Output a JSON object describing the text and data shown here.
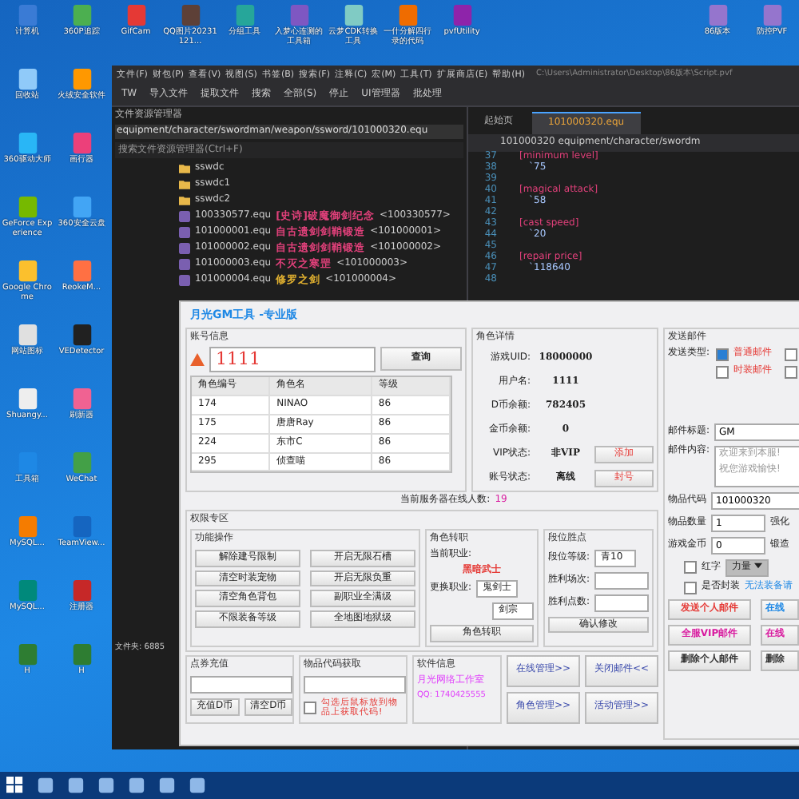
{
  "desktop": {
    "top_icons": [
      {
        "label": "计算机",
        "color": "#3a7bd5"
      },
      {
        "label": "360P追踪",
        "color": "#4caf50"
      },
      {
        "label": "GifCam",
        "color": "#e53935"
      },
      {
        "label": "QQ图片20231121...",
        "color": "#5d4037"
      },
      {
        "label": "分组工具",
        "color": "#26a69a"
      },
      {
        "label": "入梦心连测的工具箱",
        "color": "#7e57c2"
      },
      {
        "label": "云梦CDK转换工具",
        "color": "#80cbc4"
      },
      {
        "label": "一什分解四行录的代码",
        "color": "#ef6c00"
      },
      {
        "label": "pvfUtility",
        "color": "#8e24aa"
      }
    ],
    "right_icons": [
      {
        "label": "86版本",
        "color": "#9575cd"
      },
      {
        "label": "防控PVF",
        "color": "#9575cd"
      }
    ],
    "left_icons": [
      {
        "label": "回收站",
        "color": "#90caf9"
      },
      {
        "label": "火绒安全软件",
        "color": "#ff9800"
      },
      {
        "label": "360驱动大师",
        "color": "#29b6f6"
      },
      {
        "label": "画行器",
        "color": "#ec407a"
      },
      {
        "label": "GeForce Experience",
        "color": "#76b900"
      },
      {
        "label": "360安全云盘",
        "color": "#42a5f5"
      },
      {
        "label": "Google Chrome",
        "color": "#fbc02d"
      },
      {
        "label": "ReokeM...",
        "color": "#ff7043"
      },
      {
        "label": "网站图标",
        "color": "#e0e0e0"
      },
      {
        "label": "VEDetector",
        "color": "#212121"
      },
      {
        "label": "Shuangy...",
        "color": "#eeeeee"
      },
      {
        "label": "刷新器",
        "color": "#f06292"
      },
      {
        "label": "工具箱",
        "color": "#1e88e5"
      },
      {
        "label": "WeChat",
        "color": "#43a047"
      },
      {
        "label": "MySQL...",
        "color": "#f57c00"
      },
      {
        "label": "TeamView...",
        "color": "#1565c0"
      },
      {
        "label": "MySQL...",
        "color": "#00897b"
      },
      {
        "label": "注册器",
        "color": "#c62828"
      },
      {
        "label": "H",
        "color": "#2e7d32"
      },
      {
        "label": "H",
        "color": "#2e7d32"
      }
    ]
  },
  "editor": {
    "menu": [
      "文件(F)",
      "财包(P)",
      "查看(V)",
      "视图(S)",
      "书签(B)",
      "搜索(F)",
      "注释(C)",
      "宏(M)",
      "工具(T)",
      "扩展商店(E)",
      "帮助(H)"
    ],
    "path": "C:\\Users\\Administrator\\Desktop\\86版本\\Script.pvf",
    "toolbar": [
      "TW",
      "导入文件",
      "提取文件",
      "搜索",
      "全部(S)",
      "停止",
      "UI管理器",
      "批处理"
    ],
    "explorer": {
      "title": "文件资源管理器",
      "path": "equipment/character/swordman/weapon/ssword/101000320.equ",
      "search_placeholder": "搜索文件资源管理器(Ctrl+F)",
      "folders": [
        "sswdc",
        "sswdc1",
        "sswdc2"
      ],
      "files": [
        {
          "name": "100330577.equ",
          "desc": "[史诗]破魔御剑纪念",
          "code": "<100330577>",
          "color": "#e0407a"
        },
        {
          "name": "101000001.equ",
          "desc": "自古遗剑剑鞘锻造",
          "code": "<101000001>",
          "color": "#e0407a"
        },
        {
          "name": "101000002.equ",
          "desc": "自古遗剑剑鞘锻造",
          "code": "<101000002>",
          "color": "#e0407a"
        },
        {
          "name": "101000003.equ",
          "desc": "不灭之寒罡",
          "code": "<101000003>",
          "color": "#e0407a"
        },
        {
          "name": "101000004.equ",
          "desc": "修罗之剑",
          "code": "<101000004>",
          "color": "#e0b030"
        }
      ],
      "status": "文件夹: 6885"
    },
    "tabs": [
      {
        "label": "起始页",
        "selected": false
      },
      {
        "label": "101000320.equ",
        "selected": true
      }
    ],
    "code_path": "101000320  equipment/character/swordm",
    "lines": [
      {
        "no": "37",
        "text": "[minimum level]",
        "kind": "tag"
      },
      {
        "no": "38",
        "text": "`75",
        "kind": "value"
      },
      {
        "no": "39",
        "kind": "blank"
      },
      {
        "no": "40",
        "text": "[magical attack]",
        "kind": "tag"
      },
      {
        "no": "41",
        "text": "`58",
        "kind": "value"
      },
      {
        "no": "42",
        "kind": "blank"
      },
      {
        "no": "43",
        "text": "[cast speed]",
        "kind": "tag"
      },
      {
        "no": "44",
        "text": "`20",
        "kind": "value"
      },
      {
        "no": "45",
        "kind": "blank"
      },
      {
        "no": "46",
        "text": "[repair price]",
        "kind": "tag"
      },
      {
        "no": "47",
        "text": "`118640",
        "kind": "value"
      },
      {
        "no": "48",
        "kind": "blank"
      }
    ]
  },
  "gm": {
    "title": "月光GM工具 -专业版",
    "account": {
      "title": "账号信息",
      "value": "1111",
      "query": "查询",
      "columns": [
        "角色编号",
        "角色名",
        "等级"
      ],
      "rows": [
        [
          "174",
          "NINAO",
          "86"
        ],
        [
          "175",
          "唐唐Ray",
          "86"
        ],
        [
          "224",
          "东市C",
          "86"
        ],
        [
          "295",
          "侦查喵",
          "86"
        ]
      ]
    },
    "detail": {
      "title": "角色详情",
      "rows": [
        {
          "label": "游戏UID:",
          "value": "18000000"
        },
        {
          "label": "用户名:",
          "value": "1111"
        },
        {
          "label": "D币余额:",
          "value": "782405"
        },
        {
          "label": "金币余额:",
          "value": "0"
        },
        {
          "label": "VIP状态:",
          "value": "非VIP",
          "action": "添加"
        },
        {
          "label": "账号状态:",
          "value": "离线",
          "action": "封号"
        }
      ]
    },
    "online_label": "当前服务器在线人数:",
    "online": "19",
    "perm": {
      "title": "权限专区",
      "ops_title": "功能操作",
      "ops": [
        "解除建号限制",
        "开启无限石槽",
        "清空时装宠物",
        "开启无限负重",
        "清空角色背包",
        "副职业全满级",
        "不限装备等级",
        "全地图地狱级"
      ],
      "job": {
        "title": "角色转职",
        "current_label": "当前职业:",
        "current": "黑暗武士",
        "change_label": "更换职业:",
        "job": "鬼剑士",
        "sub": "剑宗",
        "button": "角色转职"
      },
      "rank": {
        "title": "段位胜点",
        "level_label": "段位等级:",
        "level": "青10",
        "wins_label": "胜利场次:",
        "points_label": "胜利点数:",
        "button": "确认修改"
      }
    },
    "recharge": {
      "title": "点券充值",
      "buttons": [
        "充值D币",
        "清空D币"
      ]
    },
    "itemcode": {
      "title": "物品代码获取",
      "hint": "勾选后鼠标放到物品上获取代码!",
      "checked": false
    },
    "info": {
      "title": "软件信息",
      "studio": "月光网络工作室",
      "qq": "QQ: 1740425555"
    },
    "nav": [
      "在线管理>>",
      "关闭邮件<<",
      "角色管理>>",
      "活动管理>>"
    ],
    "mail": {
      "title": "发送邮件",
      "type_label": "发送类型:",
      "types": [
        {
          "label": "普通邮件",
          "checked": true
        },
        {
          "checked": false
        },
        {
          "label": "时装邮件",
          "checked": false
        },
        {
          "checked": false
        }
      ],
      "subject_label": "邮件标题:",
      "subject": "GM",
      "content_label": "邮件内容:",
      "content": [
        "欢迎来到本服!",
        "祝您游戏愉快!"
      ],
      "fields": [
        {
          "label": "物品代码",
          "value": "101000320"
        },
        {
          "label": "物品数量",
          "value": "1",
          "extra": "强化"
        },
        {
          "label": "游戏金币",
          "value": "0",
          "extra": "锻造"
        }
      ],
      "red_label": "红字",
      "red": false,
      "stat": "力量",
      "seal_label": "是否封装",
      "seal": false,
      "seal_note": "无法装备请",
      "buttons": [
        {
          "label": "发送个人邮件",
          "color": "#e53935"
        },
        {
          "label": "在线",
          "color": "#1e88e5"
        },
        {
          "label": "全服VIP邮件",
          "color": "#d81b9f"
        },
        {
          "label": "在线",
          "color": "#d81b9f"
        },
        {
          "label": "删除个人邮件",
          "color": "#333333"
        },
        {
          "label": "删除",
          "color": "#333333"
        }
      ]
    }
  }
}
